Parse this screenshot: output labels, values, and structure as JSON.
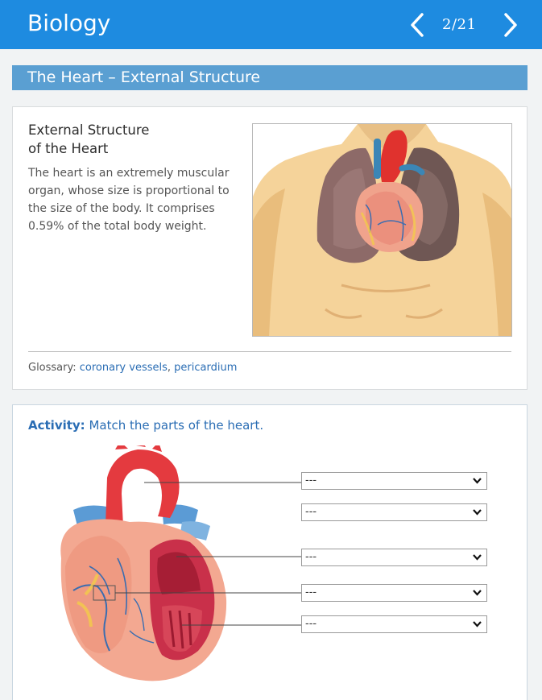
{
  "app": {
    "title": "Biology"
  },
  "nav": {
    "page_indicator": "2/21"
  },
  "section": {
    "title": "The Heart – External Structure"
  },
  "content": {
    "title": "External Structure\nof the Heart",
    "body": "The heart is an extremely muscular organ, whose size is proportional to the size of the body. It comprises 0.59% of the total body weight.",
    "glossary_label": "Glossary:",
    "glossary_links": [
      "coronary vessels",
      "pericardium"
    ]
  },
  "activity": {
    "label": "Activity:",
    "instruction": "Match the parts of the heart.",
    "selects": [
      {
        "value": "---"
      },
      {
        "value": "---"
      },
      {
        "value": "---"
      },
      {
        "value": "---"
      },
      {
        "value": "---"
      }
    ]
  },
  "colors": {
    "appbar": "#1e8be0",
    "section_header": "#5a9fd2",
    "link": "#2a6db4"
  },
  "icons": {
    "prev": "chevron-left-icon",
    "next": "chevron-right-icon",
    "select": "chevron-down-icon"
  }
}
